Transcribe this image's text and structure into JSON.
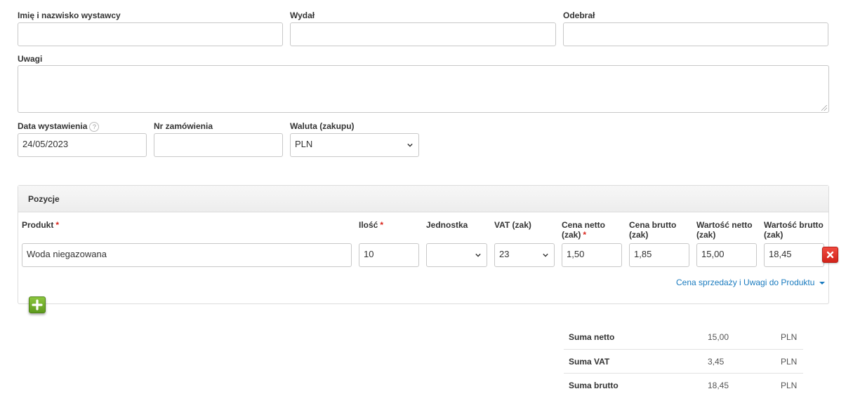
{
  "form": {
    "issuer_label": "Imię i nazwisko wystawcy",
    "issuer_value": "",
    "issued_label": "Wydał",
    "issued_value": "",
    "received_label": "Odebrał",
    "received_value": "",
    "notes_label": "Uwagi",
    "notes_value": "",
    "issue_date_label": "Data wystawienia",
    "issue_date_help": "?",
    "issue_date_value": "24/05/2023",
    "order_no_label": "Nr zamówienia",
    "order_no_value": "",
    "currency_label": "Waluta (zakupu)",
    "currency_value": "PLN"
  },
  "positions": {
    "title": "Pozycje",
    "columns": {
      "product": "Produkt",
      "quantity": "Ilość",
      "unit": "Jednostka",
      "vat": "VAT (zak)",
      "net_price_1": "Cena netto",
      "net_price_2": "(zak)",
      "gross_price_1": "Cena brutto",
      "gross_price_2": "(zak)",
      "net_value_1": "Wartość netto",
      "net_value_2": "(zak)",
      "gross_value_1": "Wartość brutto",
      "gross_value_2": "(zak)",
      "required_mark": "*"
    },
    "rows": [
      {
        "product": "Woda niegazowana",
        "quantity": "10",
        "unit": "",
        "vat": "23",
        "net_price": "1,50",
        "gross_price": "1,85",
        "net_value": "15,00",
        "gross_value": "18,45"
      }
    ],
    "more_link": "Cena sprzedaży i Uwagi do Produktu"
  },
  "summary": [
    {
      "label": "Suma netto",
      "value": "15,00",
      "currency": "PLN"
    },
    {
      "label": "Suma VAT",
      "value": "3,45",
      "currency": "PLN"
    },
    {
      "label": "Suma brutto",
      "value": "18,45",
      "currency": "PLN"
    }
  ],
  "colors": {
    "link": "#1a7bbf",
    "required": "#d9251c",
    "delete_button": "#e0342a",
    "add_button": "#6fae2c"
  },
  "icons": {
    "delete": "close-icon",
    "add": "plus-icon",
    "select": "chevron-down-icon",
    "link_caret": "caret-down-icon",
    "help": "help-icon"
  }
}
